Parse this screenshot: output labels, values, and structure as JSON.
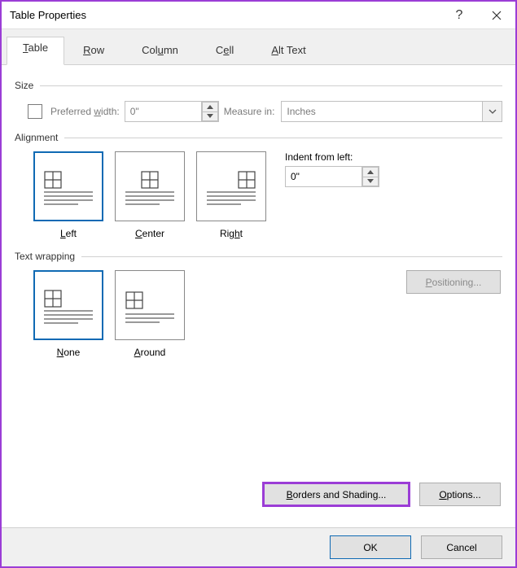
{
  "titlebar": {
    "title": "Table Properties",
    "help": "?",
    "close": "✕"
  },
  "tabs": {
    "table_pre": "",
    "table_u": "T",
    "table_post": "able",
    "row_pre": "",
    "row_u": "R",
    "row_post": "ow",
    "col_pre": "Col",
    "col_u": "u",
    "col_post": "mn",
    "cell_pre": "C",
    "cell_u": "e",
    "cell_post": "ll",
    "alt_pre": "",
    "alt_u": "A",
    "alt_post": "lt Text"
  },
  "size": {
    "header": "Size",
    "pref_pre": "Preferred ",
    "pref_u": "w",
    "pref_post": "idth:",
    "width_value": "0\"",
    "measure_label": "Measure in:",
    "measure_value": "Inches"
  },
  "alignment": {
    "header": "Alignment",
    "left_pre": "",
    "left_u": "L",
    "left_post": "eft",
    "center_pre": "",
    "center_u": "C",
    "center_post": "enter",
    "right_pre": "Rig",
    "right_u": "h",
    "right_post": "t",
    "indent_pre": "",
    "indent_u": "I",
    "indent_post": "ndent from left:",
    "indent_value": "0\""
  },
  "wrapping": {
    "header": "Text wrapping",
    "none_pre": "",
    "none_u": "N",
    "none_post": "one",
    "around_pre": "",
    "around_u": "A",
    "around_post": "round",
    "positioning_pre": "",
    "positioning_u": "P",
    "positioning_post": "ositioning..."
  },
  "buttons": {
    "borders_pre": "",
    "borders_u": "B",
    "borders_post": "orders and Shading...",
    "options_pre": "",
    "options_u": "O",
    "options_post": "ptions...",
    "ok": "OK",
    "cancel": "Cancel"
  }
}
